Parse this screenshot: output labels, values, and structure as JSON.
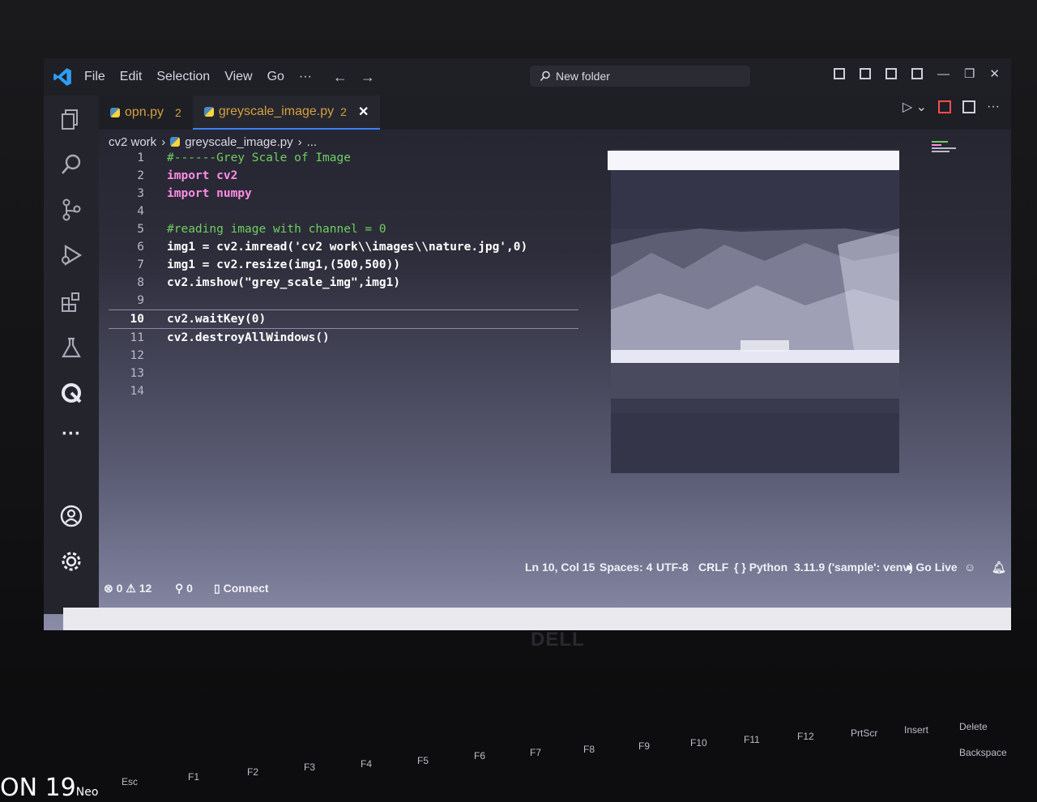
{
  "titlebar": {
    "menu": [
      "File",
      "Edit",
      "Selection",
      "View",
      "Go",
      "···"
    ],
    "search": "New folder"
  },
  "tabs": [
    {
      "label": "opn.py",
      "count": "2",
      "active": false
    },
    {
      "label": "greyscale_image.py",
      "count": "2",
      "active": true
    }
  ],
  "breadcrumb": {
    "folder": "cv2 work",
    "file": "greyscale_image.py",
    "more": "..."
  },
  "code": [
    {
      "n": "1",
      "text": "#------Grey Scale of Image"
    },
    {
      "n": "2",
      "text": "import cv2"
    },
    {
      "n": "3",
      "text": "import numpy"
    },
    {
      "n": "4",
      "text": ""
    },
    {
      "n": "5",
      "text": "#reading image with channel = 0"
    },
    {
      "n": "6",
      "text": "img1 = cv2.imread('cv2 work\\\\images\\\\nature.jpg',0)"
    },
    {
      "n": "7",
      "text": "img1 = cv2.resize(img1,(500,500))"
    },
    {
      "n": "8",
      "text": "cv2.imshow(\"grey_scale_img\",img1)"
    },
    {
      "n": "9",
      "text": ""
    },
    {
      "n": "10",
      "text": "cv2.waitKey(0)"
    },
    {
      "n": "11",
      "text": "cv2.destroyAllWindows()"
    },
    {
      "n": "12",
      "text": ""
    },
    {
      "n": "13",
      "text": ""
    },
    {
      "n": "14",
      "text": ""
    }
  ],
  "status": {
    "errors": "0",
    "warnings": "12",
    "ports": "0",
    "connect": "Connect",
    "position": "Ln 10, Col 15",
    "spaces": "Spaces: 4",
    "encoding": "UTF-8",
    "eol": "CRLF",
    "language": "Python",
    "interpreter": "3.11.9 ('sample': venv)",
    "golive": "Go Live"
  },
  "keyboard": [
    "Esc",
    "F1",
    "F2",
    "F3",
    "F4",
    "F5",
    "F6",
    "F7",
    "F8",
    "F9",
    "F10",
    "F11",
    "F12",
    "PrtScr",
    "Insert",
    "Delete",
    "Backspace"
  ],
  "brand": "DELL",
  "watermark": {
    "main": "ON 19",
    "sub": "Neo"
  },
  "colors": {
    "accent": "#3b82f6",
    "tab_text": "#d5a13a",
    "keyword": "#ff8de4",
    "comment": "#6fcf5f"
  }
}
